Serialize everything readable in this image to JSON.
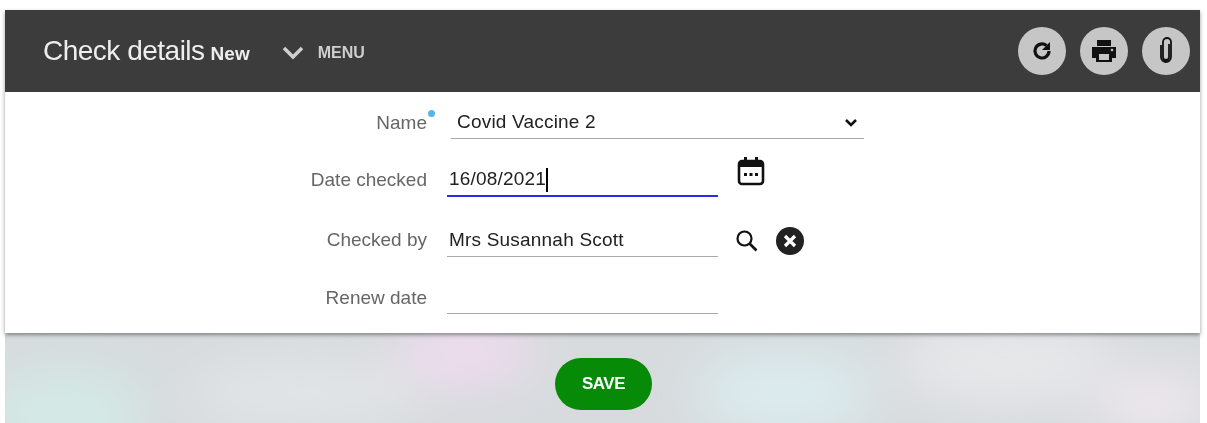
{
  "header": {
    "title": "Check details",
    "badge": "New",
    "menu_label": "MENU"
  },
  "fields": [
    {
      "kind": "select",
      "label": "Name",
      "required": true,
      "value": "Covid Vaccine 2",
      "focused": false
    },
    {
      "kind": "date",
      "label": "Date checked",
      "required": false,
      "value": "16/08/2021",
      "focused": true
    },
    {
      "kind": "lookup",
      "label": "Checked by",
      "required": false,
      "value": "Mrs Susannah Scott",
      "focused": false
    },
    {
      "kind": "text",
      "label": "Renew date",
      "required": false,
      "focused": false
    }
  ],
  "save_button": {
    "label": "SAVE"
  }
}
